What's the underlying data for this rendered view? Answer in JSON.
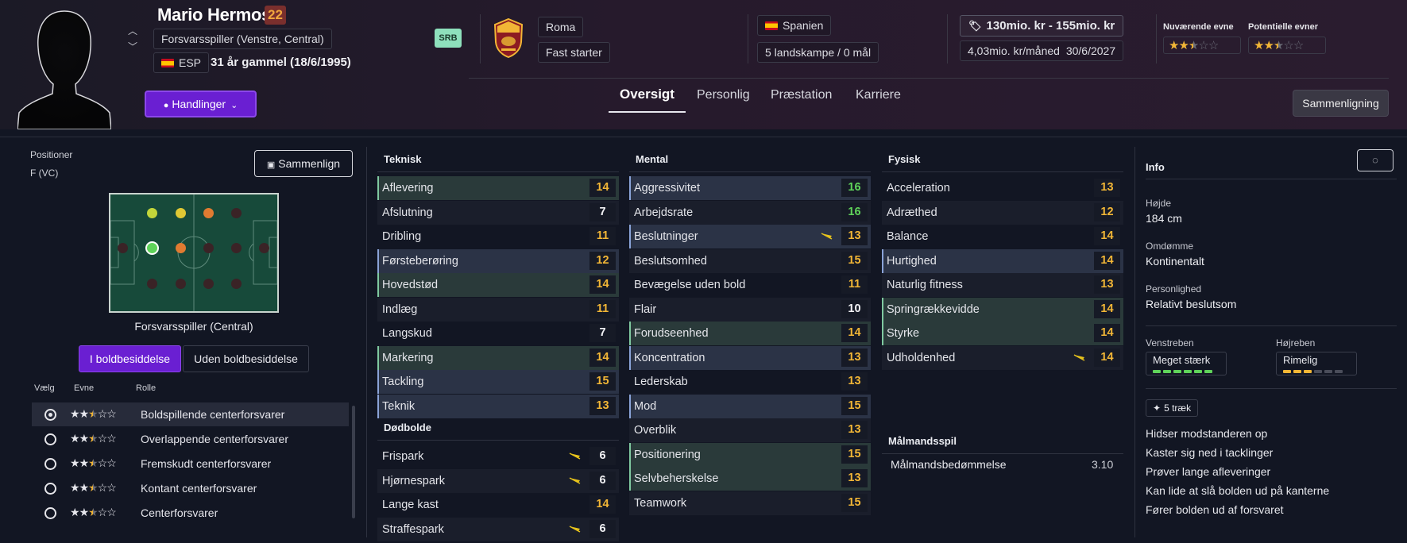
{
  "player": {
    "name": "Mario Hermoso",
    "age_badge": "22",
    "position": "Forsvarsspiller (Venstre, Central)",
    "nationality_code": "ESP",
    "age_text": "31 år gammel (18/6/1995)",
    "personality_badge": "SRB"
  },
  "club": {
    "name": "Roma",
    "label": "Fast starter"
  },
  "national": {
    "country": "Spanien",
    "caps": "5 landskampe / 0 mål"
  },
  "contract": {
    "value_range": "130mio. kr - 155mio. kr",
    "wage": "4,03mio. kr/måned",
    "expires": "30/6/2027"
  },
  "ability": {
    "current_label": "Nuværende evne",
    "potential_label": "Potentielle evner",
    "current_stars": 2.5,
    "potential_stars": 2.5
  },
  "actions": {
    "label": "Handlinger"
  },
  "tabs": [
    "Oversigt",
    "Personlig",
    "Præstation",
    "Karriere"
  ],
  "compare_top": "Sammenligning",
  "positions": {
    "title": "Positioner",
    "code": "F (VC)",
    "compare_button": "Sammenlign",
    "role_caption": "Forsvarsspiller (Central)",
    "toggle_in": "I boldbesiddelse",
    "toggle_out": "Uden boldbesiddelse",
    "col_select": "Vælg",
    "col_ability": "Evne",
    "col_role": "Rolle",
    "roles": [
      {
        "name": "Boldspillende centerforsvarer",
        "stars": 2.5,
        "selected": true
      },
      {
        "name": "Overlappende centerforsvarer",
        "stars": 2.5,
        "selected": false
      },
      {
        "name": "Fremskudt centerforsvarer",
        "stars": 2.5,
        "selected": false
      },
      {
        "name": "Kontant centerforsvarer",
        "stars": 2.5,
        "selected": false
      },
      {
        "name": "Centerforsvarer",
        "stars": 2.5,
        "selected": false
      }
    ]
  },
  "technical": {
    "title": "Teknisk",
    "rows": [
      {
        "name": "Aflevering",
        "value": "14"
      },
      {
        "name": "Afslutning",
        "value": "7"
      },
      {
        "name": "Dribling",
        "value": "11"
      },
      {
        "name": "Førsteberøring",
        "value": "12"
      },
      {
        "name": "Hovedstød",
        "value": "14"
      },
      {
        "name": "Indlæg",
        "value": "11"
      },
      {
        "name": "Langskud",
        "value": "7"
      },
      {
        "name": "Markering",
        "value": "14"
      },
      {
        "name": "Tackling",
        "value": "15"
      },
      {
        "name": "Teknik",
        "value": "13"
      }
    ]
  },
  "set_pieces": {
    "title": "Dødbolde",
    "rows": [
      {
        "name": "Frispark",
        "value": "6"
      },
      {
        "name": "Hjørnespark",
        "value": "6"
      },
      {
        "name": "Lange kast",
        "value": "14"
      },
      {
        "name": "Straffespark",
        "value": "6"
      }
    ]
  },
  "mental": {
    "title": "Mental",
    "rows": [
      {
        "name": "Aggressivitet",
        "value": "16"
      },
      {
        "name": "Arbejdsrate",
        "value": "16"
      },
      {
        "name": "Beslutninger",
        "value": "13"
      },
      {
        "name": "Beslutsomhed",
        "value": "15"
      },
      {
        "name": "Bevægelse uden bold",
        "value": "11"
      },
      {
        "name": "Flair",
        "value": "10"
      },
      {
        "name": "Forudseenhed",
        "value": "14"
      },
      {
        "name": "Koncentration",
        "value": "13"
      },
      {
        "name": "Lederskab",
        "value": "13"
      },
      {
        "name": "Mod",
        "value": "15"
      },
      {
        "name": "Overblik",
        "value": "13"
      },
      {
        "name": "Positionering",
        "value": "15"
      },
      {
        "name": "Selvbeherskelse",
        "value": "13"
      },
      {
        "name": "Teamwork",
        "value": "15"
      }
    ]
  },
  "physical": {
    "title": "Fysisk",
    "rows": [
      {
        "name": "Acceleration",
        "value": "13"
      },
      {
        "name": "Adræthed",
        "value": "12"
      },
      {
        "name": "Balance",
        "value": "14"
      },
      {
        "name": "Hurtighed",
        "value": "14"
      },
      {
        "name": "Naturlig fitness",
        "value": "13"
      },
      {
        "name": "Springrækkevidde",
        "value": "14"
      },
      {
        "name": "Styrke",
        "value": "14"
      },
      {
        "name": "Udholdenhed",
        "value": "14"
      }
    ]
  },
  "goalkeeping": {
    "title": "Målmandsspil",
    "rating_label": "Målmandsbedømmelse",
    "rating_value": "3.10"
  },
  "info": {
    "title": "Info",
    "height_label": "Højde",
    "height": "184 cm",
    "reputation_label": "Omdømme",
    "reputation": "Kontinentalt",
    "personality_label": "Personlighed",
    "personality": "Relativt beslutsom",
    "left_foot_label": "Venstreben",
    "left_foot": "Meget stærk",
    "right_foot_label": "Højreben",
    "right_foot": "Rimelig",
    "left_foot_level": 6,
    "right_foot_level": 3,
    "foot_scale": 6,
    "traits_button": "5 træk",
    "traits": [
      "Hidser modstanderen op",
      "Kaster sig ned i tacklinger",
      "Prøver lange afleveringer",
      "Kan lide at slå bolden ud på kanterne",
      "Fører bolden ud af forsvaret"
    ]
  },
  "colors": {
    "accent_purple": "#6a1fd2",
    "stat_yellow": "#f2b636",
    "stat_green": "#5fd35a",
    "pitch_green": "#174a3a"
  }
}
